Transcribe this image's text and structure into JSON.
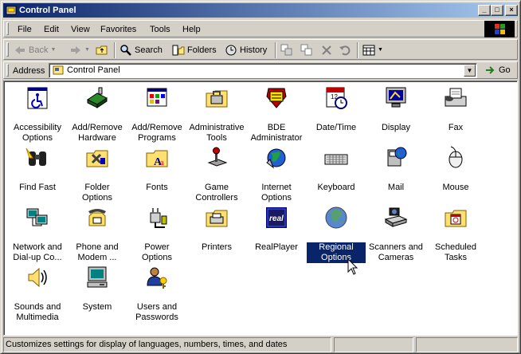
{
  "window": {
    "title": "Control Panel"
  },
  "menubar": {
    "items": [
      "File",
      "Edit",
      "View",
      "Favorites",
      "Tools",
      "Help"
    ]
  },
  "toolbar": {
    "back": "Back",
    "search": "Search",
    "folders": "Folders",
    "history": "History"
  },
  "address": {
    "label": "Address",
    "value": "Control Panel",
    "go": "Go"
  },
  "items": [
    {
      "label": "Accessibility Options",
      "icon": "accessibility-icon"
    },
    {
      "label": "Add/Remove Hardware",
      "icon": "hardware-icon"
    },
    {
      "label": "Add/Remove Programs",
      "icon": "programs-icon"
    },
    {
      "label": "Administrative Tools",
      "icon": "admin-tools-icon"
    },
    {
      "label": "BDE Administrator",
      "icon": "bde-icon"
    },
    {
      "label": "Date/Time",
      "icon": "calendar-clock-icon"
    },
    {
      "label": "Display",
      "icon": "monitor-icon"
    },
    {
      "label": "Fax",
      "icon": "fax-icon"
    },
    {
      "label": "Find Fast",
      "icon": "binoculars-icon"
    },
    {
      "label": "Folder Options",
      "icon": "folder-options-icon"
    },
    {
      "label": "Fonts",
      "icon": "fonts-folder-icon"
    },
    {
      "label": "Game Controllers",
      "icon": "joystick-icon"
    },
    {
      "label": "Internet Options",
      "icon": "globe-icon"
    },
    {
      "label": "Keyboard",
      "icon": "keyboard-icon"
    },
    {
      "label": "Mail",
      "icon": "mail-icon"
    },
    {
      "label": "Mouse",
      "icon": "mouse-icon"
    },
    {
      "label": "Network and Dial-up Co...",
      "icon": "network-icon"
    },
    {
      "label": "Phone and Modem ...",
      "icon": "phone-icon"
    },
    {
      "label": "Power Options",
      "icon": "power-plug-icon"
    },
    {
      "label": "Printers",
      "icon": "printer-icon"
    },
    {
      "label": "RealPlayer",
      "icon": "realplayer-icon"
    },
    {
      "label": "Regional Options",
      "icon": "regional-globe-icon",
      "selected": true
    },
    {
      "label": "Scanners and Cameras",
      "icon": "scanner-icon"
    },
    {
      "label": "Scheduled Tasks",
      "icon": "scheduled-tasks-icon"
    },
    {
      "label": "Sounds and Multimedia",
      "icon": "speaker-icon"
    },
    {
      "label": "System",
      "icon": "computer-icon"
    },
    {
      "label": "Users and Passwords",
      "icon": "users-keys-icon"
    }
  ],
  "status": {
    "text": "Customizes settings for display of languages, numbers, times, and dates"
  },
  "colors": {
    "titlebar_start": "#0a246a",
    "titlebar_end": "#a6caf0",
    "selection": "#0a246a",
    "face": "#d4d0c8"
  }
}
